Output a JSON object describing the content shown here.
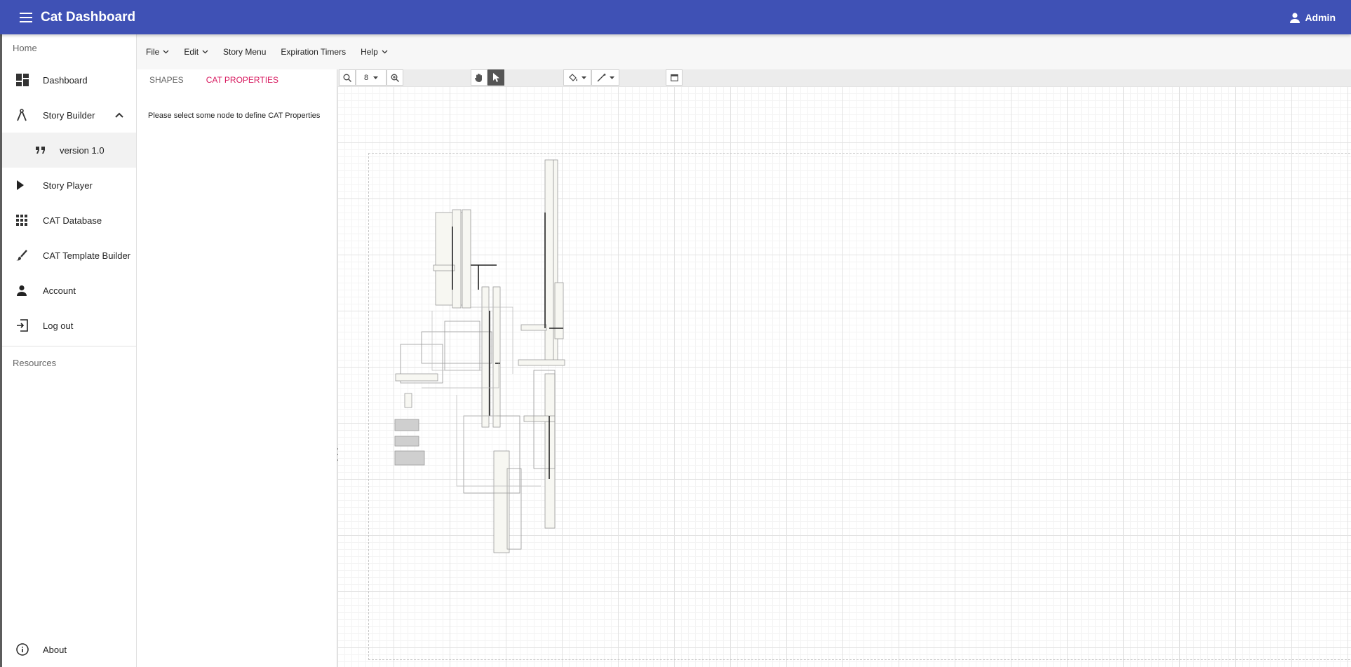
{
  "app": {
    "title": "Cat Dashboard",
    "user_label": "Admin"
  },
  "sidebar": {
    "home_header": "Home",
    "items": [
      {
        "label": "Dashboard",
        "icon": "dashboard-icon"
      },
      {
        "label": "Story Builder",
        "icon": "compass-icon",
        "expanded": true
      },
      {
        "label": "version 1.0",
        "icon": "quote-icon",
        "selected": true
      },
      {
        "label": "Story Player",
        "icon": "play-icon"
      },
      {
        "label": "CAT Database",
        "icon": "apps-grid-icon"
      },
      {
        "label": "CAT Template Builder",
        "icon": "brush-icon"
      },
      {
        "label": "Account",
        "icon": "person-icon"
      },
      {
        "label": "Log out",
        "icon": "exit-icon"
      }
    ],
    "resources_header": "Resources",
    "about_label": "About"
  },
  "menubar": {
    "items": [
      {
        "label": "File",
        "has_dropdown": true
      },
      {
        "label": "Edit",
        "has_dropdown": true
      },
      {
        "label": "Story Menu",
        "has_dropdown": false
      },
      {
        "label": "Expiration Timers",
        "has_dropdown": false
      },
      {
        "label": "Help",
        "has_dropdown": true
      }
    ]
  },
  "panel": {
    "tabs": [
      {
        "label": "SHAPES",
        "active": false
      },
      {
        "label": "CAT PROPERTIES",
        "active": true
      }
    ],
    "empty_message": "Please select some node to define CAT Properties"
  },
  "toolbar": {
    "zoom_value": "8",
    "tools": [
      "zoom-out-icon",
      "zoom-in-icon",
      "pan-hand-icon",
      "pointer-icon",
      "fill-color-icon",
      "line-style-icon",
      "calendar-icon"
    ],
    "active_tool": "pointer-icon"
  },
  "colors": {
    "appbar": "#3f51b5",
    "active_tab": "#d81b60"
  }
}
